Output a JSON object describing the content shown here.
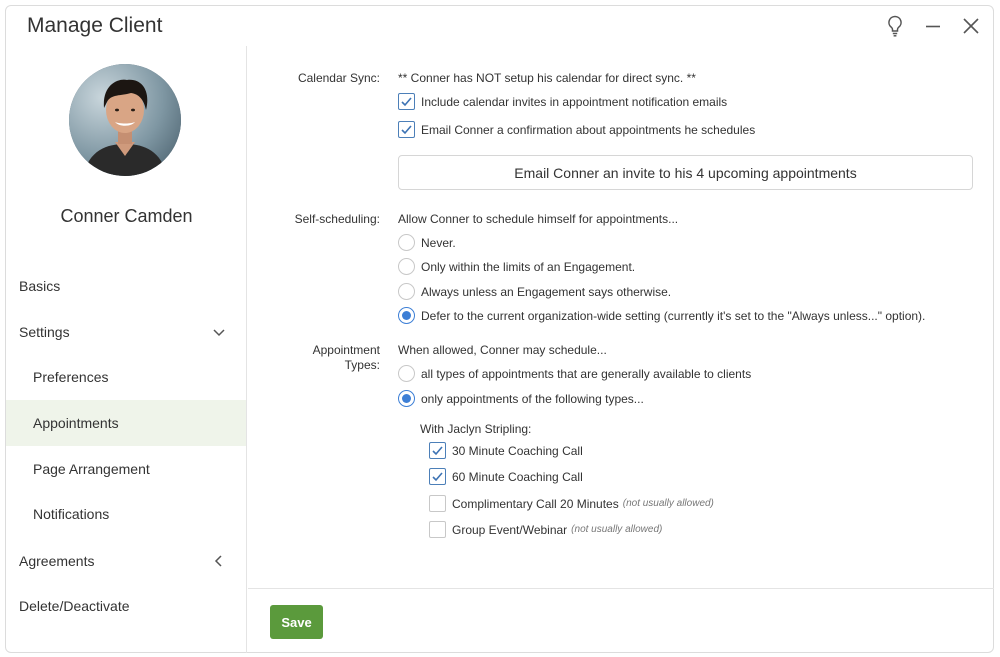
{
  "window": {
    "title": "Manage Client"
  },
  "title_icons": [
    "lightbulb-icon",
    "minimize-icon",
    "close-icon"
  ],
  "client": {
    "name": "Conner Camden"
  },
  "sidebar": {
    "items": [
      {
        "label": "Basics"
      },
      {
        "label": "Settings"
      },
      {
        "label": "Preferences"
      },
      {
        "label": "Appointments"
      },
      {
        "label": "Page Arrangement"
      },
      {
        "label": "Notifications"
      },
      {
        "label": "Agreements"
      },
      {
        "label": "Delete/Deactivate"
      }
    ]
  },
  "calendar_sync": {
    "label": "Calendar Sync:",
    "status": "** Conner has NOT setup his calendar for direct sync. **",
    "include_invites": {
      "label": "Include calendar invites in appointment notification emails",
      "checked": true
    },
    "email_confirmation": {
      "label": "Email Conner a confirmation about appointments he schedules",
      "checked": true
    },
    "invite_button": "Email Conner an invite to his 4 upcoming appointments"
  },
  "self_scheduling": {
    "label": "Self-scheduling:",
    "intro": "Allow Conner to schedule himself for appointments...",
    "options": [
      {
        "label": "Never.",
        "selected": false
      },
      {
        "label": "Only within the limits of an Engagement.",
        "selected": false
      },
      {
        "label": "Always unless an Engagement says otherwise.",
        "selected": false
      },
      {
        "label": "Defer to the current organization-wide setting (currently it's set to the \"Always unless...\" option).",
        "selected": true
      }
    ]
  },
  "appointment_types": {
    "label_line1": "Appointment",
    "label_line2": "Types:",
    "intro": "When allowed, Conner may schedule...",
    "options": [
      {
        "label": "all types of appointments that are generally available to clients",
        "selected": false
      },
      {
        "label": "only appointments of the following types...",
        "selected": true
      }
    ],
    "group_label": "With Jaclyn Stripling:",
    "types": [
      {
        "label": "30 Minute Coaching Call",
        "note": "",
        "checked": true
      },
      {
        "label": "60 Minute Coaching Call",
        "note": "",
        "checked": true
      },
      {
        "label": "Complimentary Call 20 Minutes",
        "note": "(not usually allowed)",
        "checked": false
      },
      {
        "label": "Group Event/Webinar",
        "note": "(not usually allowed)",
        "checked": false
      }
    ]
  },
  "footer": {
    "save_label": "Save"
  },
  "colors": {
    "accent_green": "#5b9a3c",
    "radio_blue": "#3d7fd6",
    "checkbox_blue": "#4c7fb8",
    "active_nav_bg": "#eff4ea"
  }
}
